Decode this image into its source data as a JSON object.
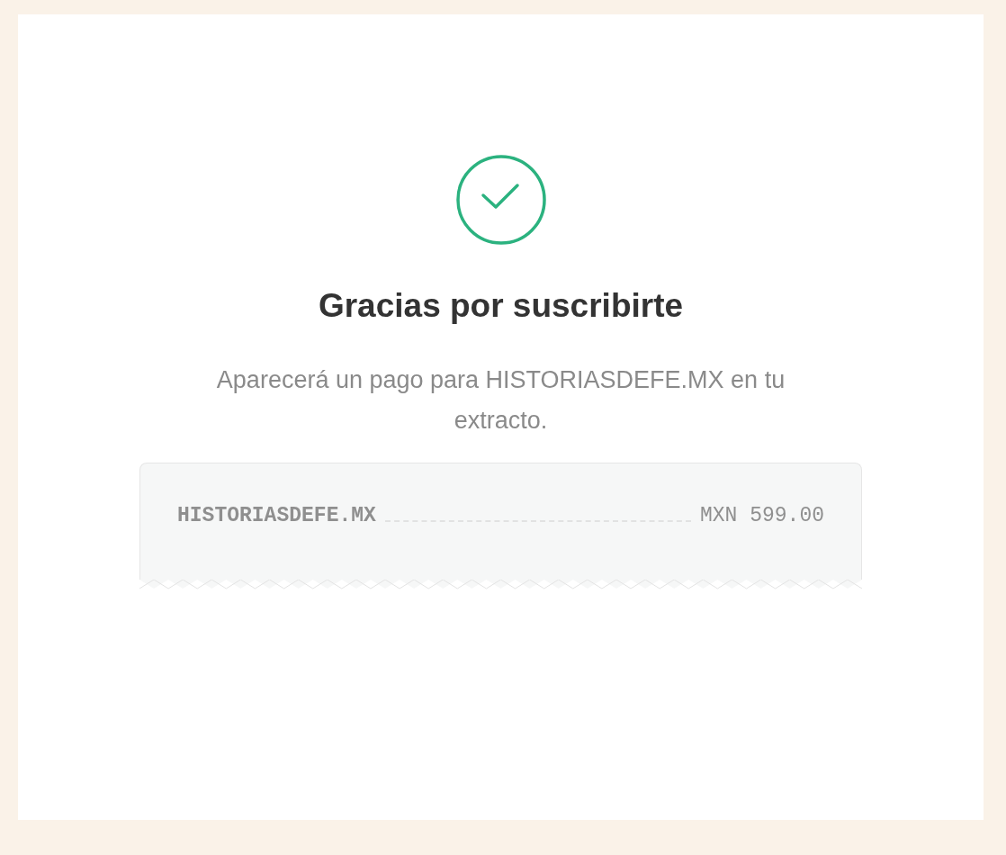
{
  "title": "Gracias por suscribirte",
  "message": "Aparecerá un pago para HISTORIASDEFE.MX en tu extracto.",
  "receipt": {
    "merchant": "HISTORIASDEFE.MX",
    "amount": "MXN 599.00"
  }
}
